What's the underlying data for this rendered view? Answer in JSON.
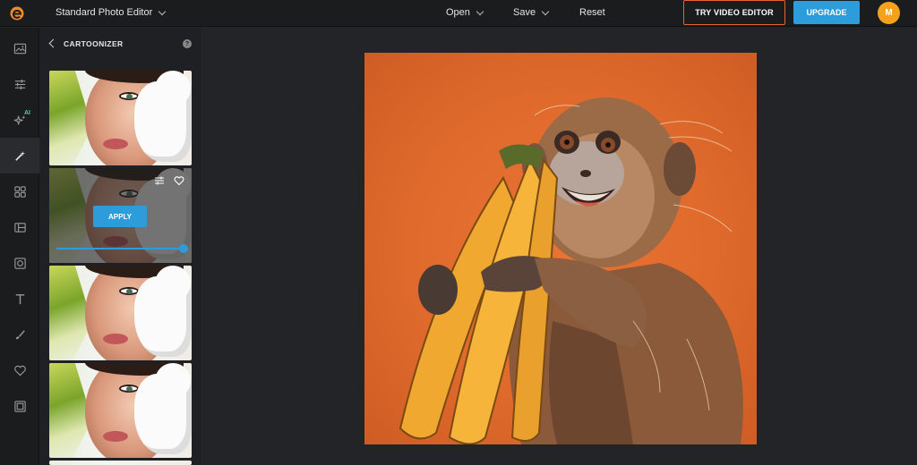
{
  "app": {
    "editor_mode": "Standard Photo Editor",
    "menu": {
      "open": "Open",
      "save": "Save",
      "reset": "Reset"
    },
    "try_video": "TRY VIDEO EDITOR",
    "upgrade": "UPGRADE",
    "avatar_initial": "M",
    "colors": {
      "accent": "#2d9cdb",
      "video_border": "#e8662e",
      "avatar": "#f5a11c",
      "ai_badge": "#3ddc97"
    }
  },
  "rail": {
    "items": [
      {
        "icon": "image-icon"
      },
      {
        "icon": "sliders-icon"
      },
      {
        "icon": "ai-sparkle-icon",
        "badge": "AI"
      },
      {
        "icon": "magic-wand-icon",
        "active": true
      },
      {
        "icon": "grid-icon"
      },
      {
        "icon": "layout-icon"
      },
      {
        "icon": "frame-icon"
      },
      {
        "icon": "text-icon"
      },
      {
        "icon": "brush-icon"
      },
      {
        "icon": "heart-icon"
      },
      {
        "icon": "border-icon"
      }
    ]
  },
  "panel": {
    "title": "CARTOONIZER",
    "help": "?",
    "selected_apply": "APPLY",
    "selected_intensity": 1.0
  }
}
